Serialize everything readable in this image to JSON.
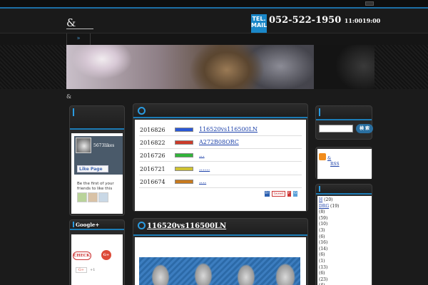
{
  "header": {
    "site_name": "&",
    "tel_badge": "TEL. MAIL",
    "tel_number": "052-522-1950",
    "tel_hours": "11:0019:00",
    "nav_item": "»",
    "breadcrumb": "&"
  },
  "news": {
    "items": [
      {
        "date": "2016826",
        "swatch": "#2a58d6",
        "link": "116520vs116500LN"
      },
      {
        "date": "2016822",
        "swatch": "#cc3b2a",
        "link": "A272B08ORC"
      },
      {
        "date": "2016726",
        "swatch": "#31b43a",
        "link": "..."
      },
      {
        "date": "2016721",
        "swatch": "#cfc232",
        "link": "......"
      },
      {
        "date": "2016674",
        "swatch": "#c87a1e",
        "link": "...."
      }
    ],
    "share_labels": [
      "B!",
      "tweet",
      "P",
      "G"
    ]
  },
  "post": {
    "title": "116520vs116500LN"
  },
  "facebook": {
    "count": "5673likes",
    "like_label": "Like Page",
    "invite_text": "Be the first of your friends to like this"
  },
  "googleplus": {
    "title": "Google+",
    "check_label": "CHECK!",
    "plus_label": "G+",
    "count": "+1"
  },
  "search": {
    "button": "検 索"
  },
  "rss": {
    "line1": "&",
    "line2": "RSS"
  },
  "categories": [
    {
      "label": "H",
      "count": "(20)"
    },
    {
      "label": "DRG",
      "count": "(19)"
    },
    {
      "label": "",
      "count": "(8)"
    },
    {
      "label": "",
      "count": "(59)"
    },
    {
      "label": "",
      "count": "(10)"
    },
    {
      "label": "",
      "count": "(3)"
    },
    {
      "label": "",
      "count": "(6)"
    },
    {
      "label": "",
      "count": "(16)"
    },
    {
      "label": "",
      "count": "(14)"
    },
    {
      "label": "",
      "count": "(6)"
    },
    {
      "label": "",
      "count": "(1)"
    },
    {
      "label": "",
      "count": "(13)"
    },
    {
      "label": "",
      "count": "(6)"
    },
    {
      "label": "",
      "count": "(23)"
    },
    {
      "label": "",
      "count": "(4)"
    },
    {
      "label": "",
      "count": "(1)"
    }
  ]
}
